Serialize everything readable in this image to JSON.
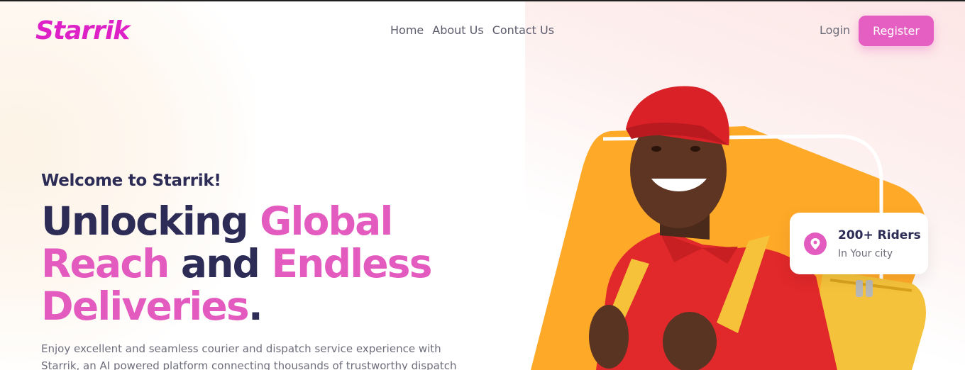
{
  "nav": {
    "brand": "Starrik",
    "links": [
      "Home",
      "About Us",
      "Contact Us"
    ],
    "login_label": "Login",
    "register_label": "Register"
  },
  "hero": {
    "welcome": "Welcome to Starrik!",
    "headline": {
      "w1": "Unlocking",
      "w2": "Global",
      "w3": "Reach",
      "w4": "and",
      "w5": "Endless",
      "w6": "Deliveries",
      "w7": "."
    },
    "description": "Enjoy excellent and seamless courier and dispatch service experience with Starrik, an AI powered platform connecting thousands of trustworthy dispatch"
  },
  "stats_card": {
    "title": "200+ Riders",
    "subtitle": "In Your city",
    "icon": "location-pin-icon"
  },
  "colors": {
    "brand": "#e45bc0",
    "dark_text": "#2c2c56",
    "accent_orange": "#ffa726"
  }
}
